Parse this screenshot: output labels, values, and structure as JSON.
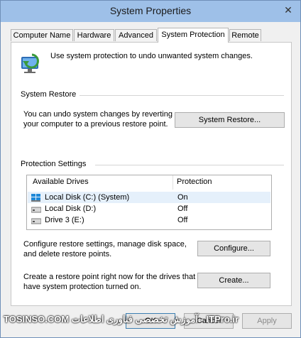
{
  "window": {
    "title": "System Properties"
  },
  "tabs": [
    {
      "label": "Computer Name"
    },
    {
      "label": "Hardware"
    },
    {
      "label": "Advanced"
    },
    {
      "label": "System Protection"
    },
    {
      "label": "Remote"
    }
  ],
  "intro": {
    "text": "Use system protection to undo unwanted system changes."
  },
  "system_restore": {
    "heading": "System Restore",
    "line1": "You can undo system changes by reverting",
    "line2": "your computer to a previous restore point.",
    "button": "System Restore..."
  },
  "protection": {
    "heading": "Protection Settings",
    "columns": [
      "Available Drives",
      "Protection"
    ],
    "drives": [
      {
        "name": "Local Disk (C:) (System)",
        "protection": "On",
        "icon": "system-drive-icon"
      },
      {
        "name": "Local Disk (D:)",
        "protection": "Off",
        "icon": "disk-drive-icon"
      },
      {
        "name": "Drive 3 (E:)",
        "protection": "Off",
        "icon": "disk-drive-icon"
      }
    ],
    "configure_line1": "Configure restore settings, manage disk space,",
    "configure_line2": "and delete restore points.",
    "configure_button": "Configure...",
    "create_line1": "Create a restore point right now for the drives that",
    "create_line2": "have system protection turned on.",
    "create_button": "Create..."
  },
  "footer": {
    "ok": "OK",
    "cancel": "Cancel",
    "apply": "Apply"
  },
  "watermark": "TOSINSO.COM   آموزش تخصصی فناوری اطلاعات - ITPro.ir",
  "colors": {
    "titlebar": "#9ec0e8",
    "selected_row": "#e5f0fb",
    "panel": "#ffffff"
  }
}
